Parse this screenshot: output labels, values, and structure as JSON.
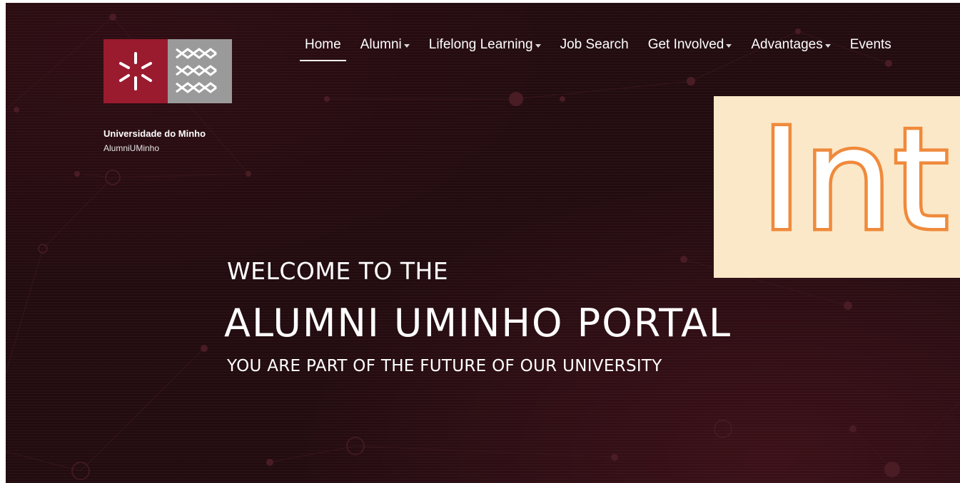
{
  "brand": {
    "university": "Universidade do Minho",
    "subtitle": "AlumniUMinho",
    "logo_red": "#9b1b2e",
    "logo_grey": "#9a9a9a"
  },
  "nav": {
    "items": [
      {
        "label": "Home",
        "active": true,
        "dropdown": false
      },
      {
        "label": "Alumni",
        "active": false,
        "dropdown": true
      },
      {
        "label": "Lifelong Learning",
        "active": false,
        "dropdown": true
      },
      {
        "label": "Job Search",
        "active": false,
        "dropdown": false
      },
      {
        "label": "Get Involved",
        "active": false,
        "dropdown": true
      },
      {
        "label": "Advantages",
        "active": false,
        "dropdown": true
      },
      {
        "label": "Events",
        "active": false,
        "dropdown": false
      }
    ]
  },
  "hero": {
    "welcome": "WELCOME TO THE",
    "title": "ALUMNI UMINHO PORTAL",
    "tagline": "YOU ARE PART OF THE FUTURE OF OUR UNIVERSITY",
    "background": "#220c10"
  },
  "promo": {
    "text": "Int",
    "background": "#fbe8c8",
    "outline": "#ef8a3b"
  }
}
